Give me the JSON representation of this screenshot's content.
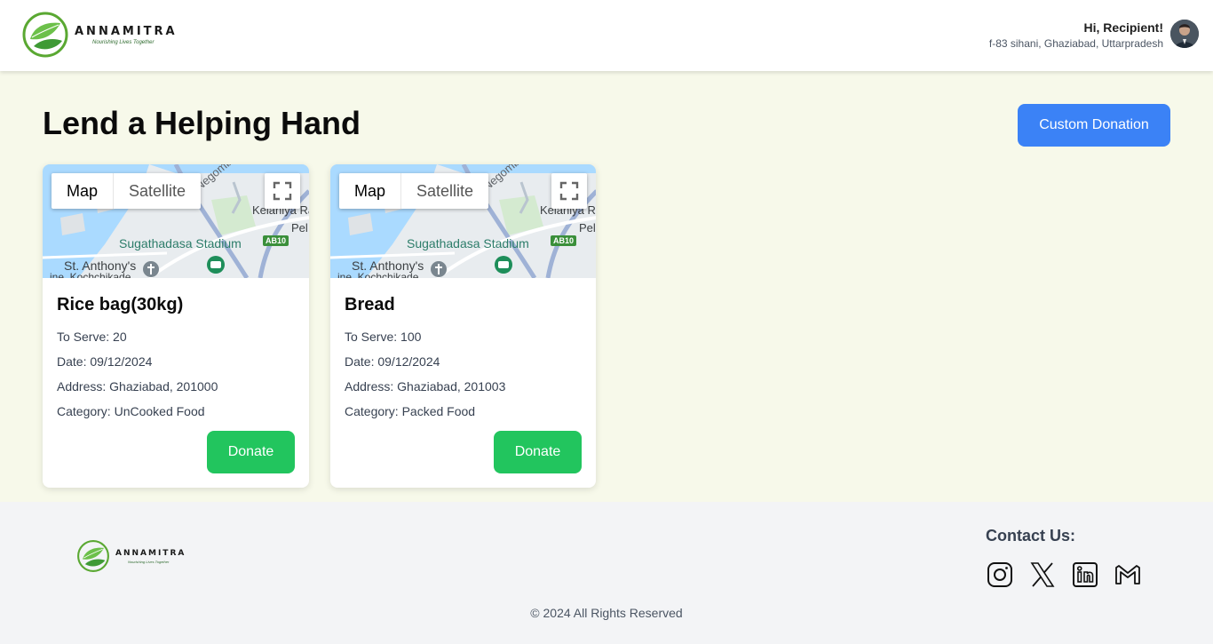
{
  "brand": {
    "name": "ANNAMITRA",
    "tagline": "Nourishing Lives Together"
  },
  "header": {
    "greeting": "Hi, Recipient!",
    "address": "f-83 sihani, Ghaziabad, Uttarpradesh"
  },
  "main": {
    "title": "Lend a Helping Hand",
    "custom_donation_label": "Custom Donation",
    "cards": [
      {
        "map": {
          "tab_map": "Map",
          "tab_satellite": "Satellite",
          "labels": {
            "stadium": "Sugathadasa Stadium",
            "church": "St. Anthony's",
            "road": "New Negombo Rd",
            "area": "Kelaniya Ra",
            "area2": "Pel",
            "area3": "ine, Kochchikade",
            "route": "AB10"
          }
        },
        "title": "Rice bag(30kg)",
        "to_serve": "To Serve: 20",
        "date": "Date: 09/12/2024",
        "address": "Address: Ghaziabad, 201000",
        "category": "Category: UnCooked Food",
        "donate_label": "Donate"
      },
      {
        "map": {
          "tab_map": "Map",
          "tab_satellite": "Satellite",
          "labels": {
            "stadium": "Sugathadasa Stadium",
            "church": "St. Anthony's",
            "road": "New Negombo Rd",
            "area": "Kelaniya Ra",
            "area2": "Pel",
            "area3": "ine, Kochchikade",
            "route": "AB10"
          }
        },
        "title": "Bread",
        "to_serve": "To Serve: 100",
        "date": "Date: 09/12/2024",
        "address": "Address: Ghaziabad, 201003",
        "category": "Category: Packed Food",
        "donate_label": "Donate"
      }
    ]
  },
  "footer": {
    "contact_title": "Contact Us:",
    "socials": [
      "instagram-icon",
      "x-twitter-icon",
      "linkedin-icon",
      "gmail-icon"
    ],
    "copyright": "© 2024 All Rights Reserved"
  },
  "colors": {
    "primary_blue": "#3b82f6",
    "donate_green": "#22c55e",
    "page_bg": "#f7f9ea",
    "footer_bg": "#f3f4f6"
  }
}
